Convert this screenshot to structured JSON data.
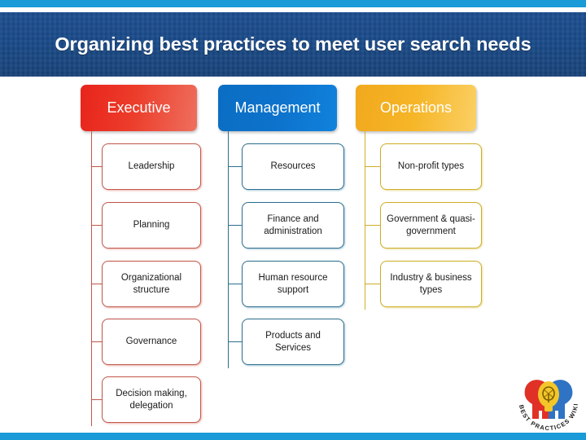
{
  "slide": {
    "title": "Organizing best practices to meet user search needs",
    "accent_cyan": "#1a9ad7",
    "title_band_color": "#1a4a88",
    "title_text_color": "#ffffff"
  },
  "diagram": {
    "type": "three-column-hierarchy",
    "columns": [
      {
        "header": "Executive",
        "color": "#ec3c2a",
        "line_color": "#c0584c",
        "items": [
          "Leadership",
          "Planning",
          "Organizational structure",
          "Governance",
          "Decision making, delegation"
        ]
      },
      {
        "header": "Management",
        "color": "#0d72cb",
        "line_color": "#2d6f8e",
        "items": [
          "Resources",
          "Finance and administration",
          "Human resource support",
          "Products and Services"
        ]
      },
      {
        "header": "Operations",
        "color": "#f6b628",
        "line_color": "#cdae2a",
        "items": [
          "Non-profit types",
          "Government & quasi-government",
          "Industry & business types"
        ]
      }
    ]
  },
  "logo": {
    "name": "best-practices-wiki-logo",
    "text": "BEST PRACTICES WIKI",
    "colors": {
      "left_figure": "#e03127",
      "right_figure": "#2f73c4",
      "bulb": "#f3c62a"
    }
  }
}
